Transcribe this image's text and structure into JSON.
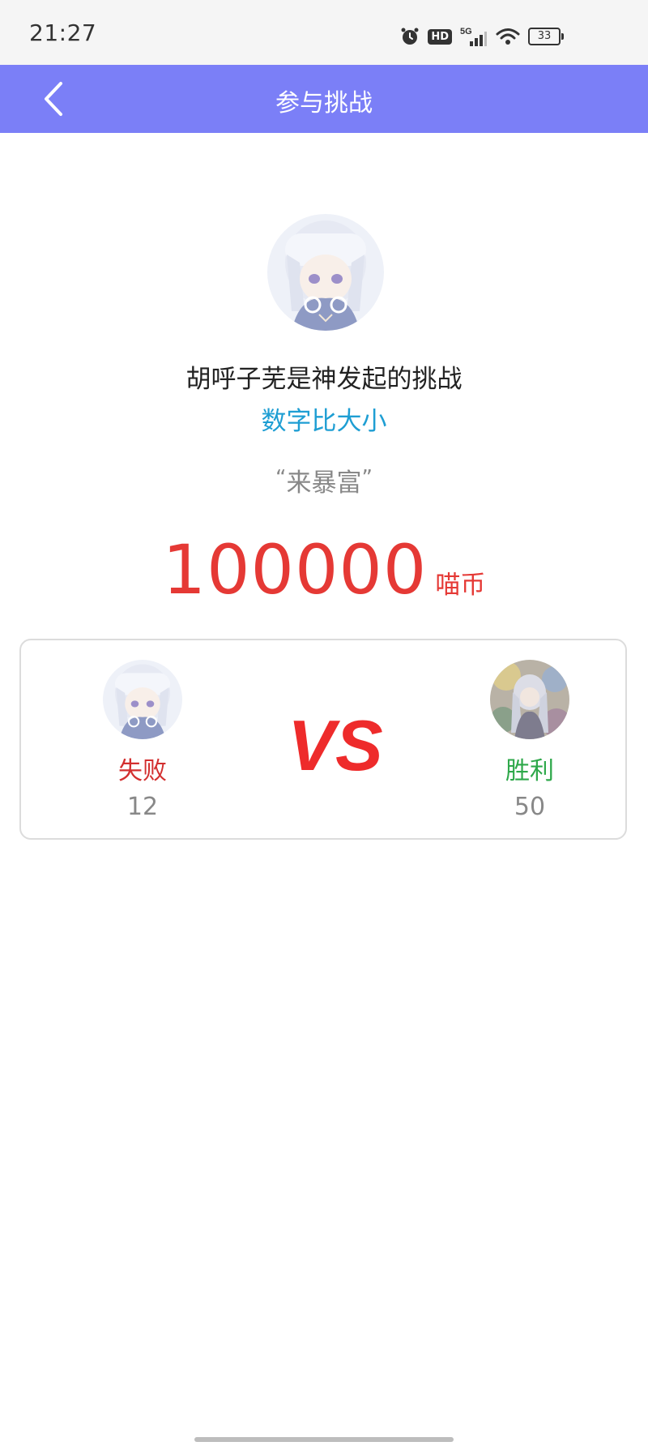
{
  "status_bar": {
    "time": "21:27",
    "network": "5G",
    "hd": "HD",
    "battery": "33"
  },
  "app_bar": {
    "title": "参与挑战"
  },
  "challenge": {
    "initiator_text": "胡呼子芜是神发起的挑战",
    "game_type": "数字比大小",
    "message": "来暴富",
    "quote_open": "“",
    "quote_close": "”",
    "stake_amount": "100000",
    "stake_unit": "喵币"
  },
  "versus": {
    "left_player": {
      "result": "失败",
      "count": "12"
    },
    "vs_label": "VS",
    "right_player": {
      "result": "胜利",
      "count": "50"
    }
  },
  "colors": {
    "app_bar": "#7b7ff7",
    "game_type": "#1e9ed3",
    "stake": "#e53935",
    "lose": "#d32f2f",
    "win": "#2ea84a"
  }
}
